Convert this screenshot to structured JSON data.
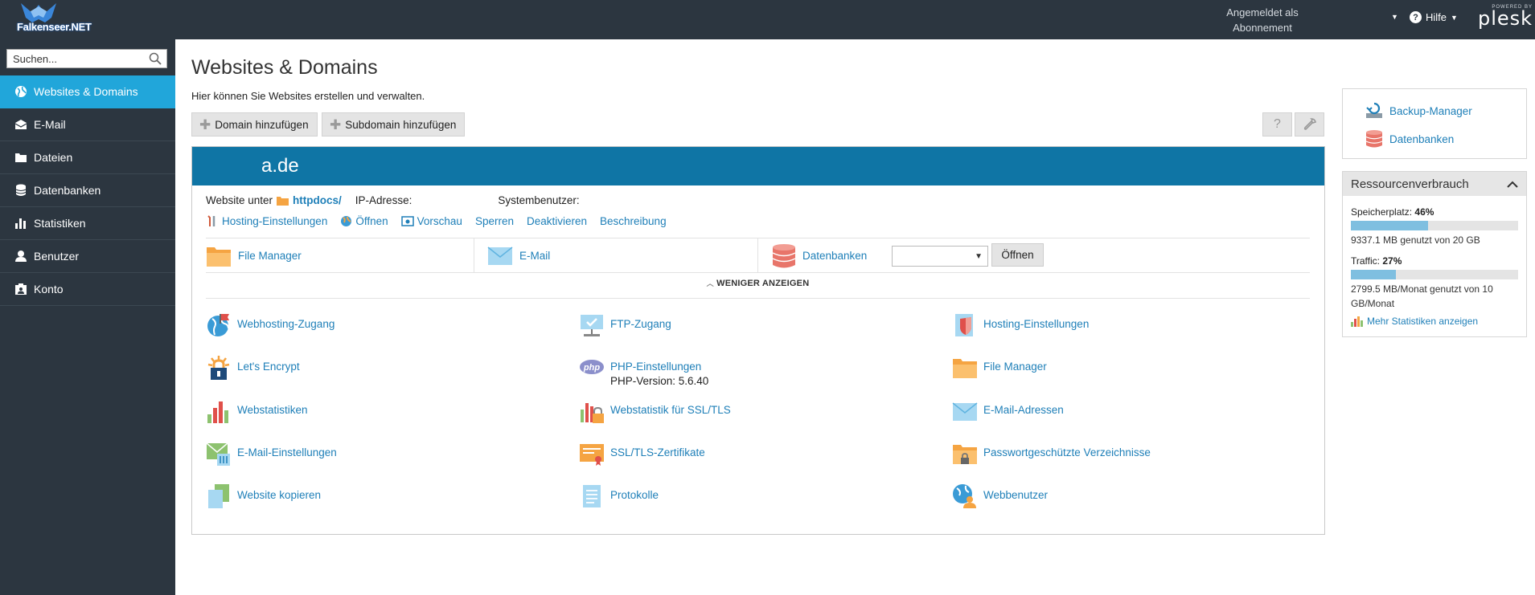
{
  "header": {
    "brand": "Falkenseer.NET",
    "logged_in_line1": "Angemeldet als",
    "logged_in_line2": "Abonnement",
    "help_label": "Hilfe",
    "powered_by": "POWERED BY",
    "plesk": "plesk"
  },
  "sidebar": {
    "search_placeholder": "Suchen...",
    "items": [
      {
        "label": "Websites & Domains",
        "icon": "globe-icon",
        "active": true
      },
      {
        "label": "E-Mail",
        "icon": "mail-icon"
      },
      {
        "label": "Dateien",
        "icon": "folder-icon"
      },
      {
        "label": "Datenbanken",
        "icon": "database-icon"
      },
      {
        "label": "Statistiken",
        "icon": "bar-chart-icon"
      },
      {
        "label": "Benutzer",
        "icon": "user-icon"
      },
      {
        "label": "Konto",
        "icon": "account-icon"
      }
    ]
  },
  "main": {
    "title": "Websites & Domains",
    "description": "Hier können Sie Websites erstellen und verwalten.",
    "add_domain": "Domain hinzufügen",
    "add_subdomain": "Subdomain hinzufügen"
  },
  "domain": {
    "name": "a.de",
    "website_under": "Website unter",
    "docroot": "httpdocs/",
    "ip_label": "IP-Adresse:",
    "sysuser_label": "Systembenutzer:",
    "links": [
      "Hosting-Einstellungen",
      "Öffnen",
      "Vorschau",
      "Sperren",
      "Deaktivieren",
      "Beschreibung"
    ],
    "quick": {
      "file_manager": "File Manager",
      "email": "E-Mail",
      "databases": "Datenbanken",
      "open": "Öffnen"
    },
    "less": "WENIGER ANZEIGEN",
    "tools": [
      {
        "label": "Webhosting-Zugang",
        "icon": "webhosting-access-icon"
      },
      {
        "label": "FTP-Zugang",
        "icon": "ftp-icon"
      },
      {
        "label": "Hosting-Einstellungen",
        "icon": "hosting-settings-icon"
      },
      {
        "label": "Let's Encrypt",
        "icon": "lets-encrypt-icon"
      },
      {
        "label": "PHP-Einstellungen",
        "icon": "php-icon",
        "sub": "PHP-Version: 5.6.40"
      },
      {
        "label": "File Manager",
        "icon": "folder-icon"
      },
      {
        "label": "Webstatistiken",
        "icon": "web-stats-icon"
      },
      {
        "label": "Webstatistik für SSL/TLS",
        "icon": "ssl-stats-icon"
      },
      {
        "label": "E-Mail-Adressen",
        "icon": "envelope-icon"
      },
      {
        "label": "E-Mail-Einstellungen",
        "icon": "mail-settings-icon"
      },
      {
        "label": "SSL/TLS-Zertifikate",
        "icon": "certificate-icon"
      },
      {
        "label": "Passwortgeschützte Verzeichnisse",
        "icon": "protected-folder-icon"
      },
      {
        "label": "Website kopieren",
        "icon": "copy-icon"
      },
      {
        "label": "Protokolle",
        "icon": "logs-icon"
      },
      {
        "label": "Webbenutzer",
        "icon": "web-user-icon"
      }
    ]
  },
  "right": {
    "backup": "Backup-Manager",
    "databases": "Datenbanken",
    "resources_title": "Ressourcenverbrauch",
    "storage_label": "Speicherplatz:",
    "storage_pct": "46%",
    "storage_fraction": 0.46,
    "storage_text": "9337.1 MB genutzt von 20 GB",
    "traffic_label": "Traffic:",
    "traffic_pct": "27%",
    "traffic_fraction": 0.27,
    "traffic_text": "2799.5 MB/Monat genutzt von 10 GB/Monat",
    "more_stats": "Mehr Statistiken anzeigen"
  }
}
